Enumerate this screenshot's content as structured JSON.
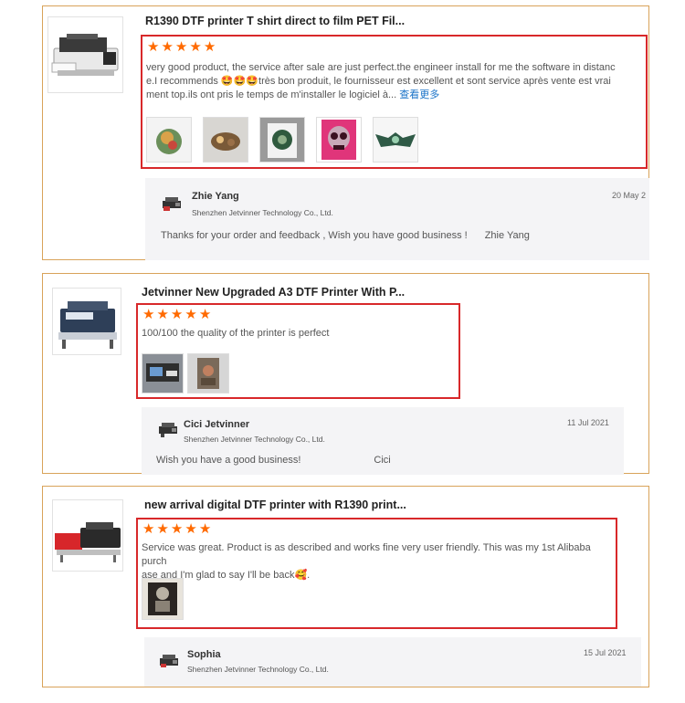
{
  "reviews": [
    {
      "product_title": "R1390 DTF printer T shirt direct to film PET Fil...",
      "stars": 5,
      "text_l1": "very good product, the service after sale are just perfect.the engineer install for me the software in distanc",
      "text_l2": "e.I recommends 🤩🤩🤩très bon produit, le fournisseur est excellent et sont service après vente est vrai",
      "text_l3": "ment top.ils ont pris le temps de m'installer le logiciel à...",
      "more_link": "查看更多",
      "photos": [
        "photo-1",
        "photo-2",
        "photo-3",
        "photo-4",
        "photo-5"
      ],
      "reply": {
        "name": "Zhie Yang",
        "company": "Shenzhen Jetvinner Technology Co., Ltd.",
        "date": "20 May 2",
        "message": "Thanks for your order and feedback , Wish you have good business !",
        "signature": "Zhie Yang"
      }
    },
    {
      "product_title": "Jetvinner New Upgraded A3 DTF Printer With P...",
      "stars": 5,
      "text_l1": "100/100 the quality of the printer is perfect",
      "photos": [
        "photo-1",
        "photo-2"
      ],
      "reply": {
        "name": "Cici Jetvinner",
        "company": "Shenzhen Jetvinner Technology Co., Ltd.",
        "date": "11 Jul 2021",
        "message": "Wish you have a good business!",
        "signature": "Cici"
      }
    },
    {
      "product_title": "new arrival digital DTF printer with R1390 print...",
      "stars": 5,
      "text_l1": "Service was great. Product is as described and works fine very user friendly. This was my 1st Alibaba purch",
      "text_l2": "ase and I'm glad to say I'll be back🥰.",
      "photos": [
        "photo-1"
      ],
      "reply": {
        "name": "Sophia",
        "company": "Shenzhen Jetvinner Technology Co., Ltd.",
        "date": "15 Jul 2021"
      }
    }
  ],
  "colors": {
    "star": "#ff6a00",
    "highlight": "#d8282a",
    "card_border": "#d9a35a",
    "link": "#1a73c8"
  },
  "icons": {
    "star": "★",
    "printer": "printer-icon",
    "avatar": "printer-avatar-icon"
  }
}
